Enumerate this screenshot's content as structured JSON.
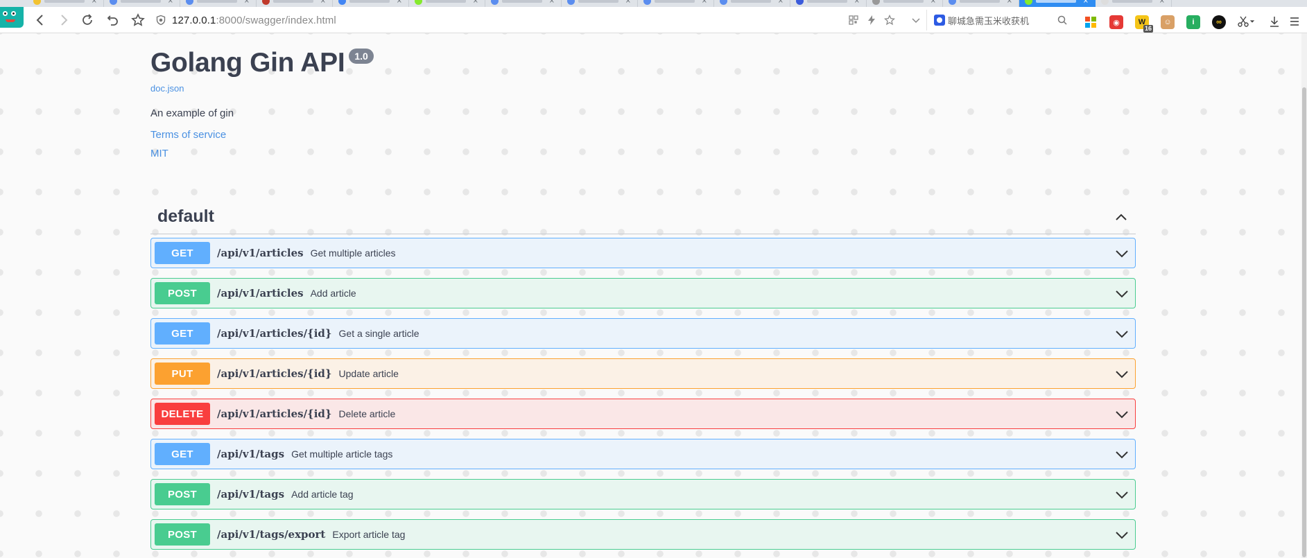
{
  "browser": {
    "url_host": "127.0.0.1",
    "url_rest": ":8000/swagger/index.html",
    "search_placeholder": "聊城急需玉米收获机",
    "extension_badge": "16",
    "colors": {
      "active_tab": "#2f8df2"
    }
  },
  "info": {
    "title": "Golang Gin API",
    "version": "1.0",
    "spec_link": "doc.json",
    "description": "An example of gin",
    "terms_link": "Terms of service",
    "license_link": "MIT"
  },
  "tag": {
    "name": "default"
  },
  "operations": [
    {
      "method": "GET",
      "path": "/api/v1/articles",
      "summary": "Get multiple articles"
    },
    {
      "method": "POST",
      "path": "/api/v1/articles",
      "summary": "Add article"
    },
    {
      "method": "GET",
      "path": "/api/v1/articles/{id}",
      "summary": "Get a single article"
    },
    {
      "method": "PUT",
      "path": "/api/v1/articles/{id}",
      "summary": "Update article"
    },
    {
      "method": "DELETE",
      "path": "/api/v1/articles/{id}",
      "summary": "Delete article"
    },
    {
      "method": "GET",
      "path": "/api/v1/tags",
      "summary": "Get multiple article tags"
    },
    {
      "method": "POST",
      "path": "/api/v1/tags",
      "summary": "Add article tag"
    },
    {
      "method": "POST",
      "path": "/api/v1/tags/export",
      "summary": "Export article tag"
    }
  ],
  "method_colors": {
    "GET": "#61affe",
    "POST": "#49cc90",
    "PUT": "#fca130",
    "DELETE": "#f93e3e"
  }
}
